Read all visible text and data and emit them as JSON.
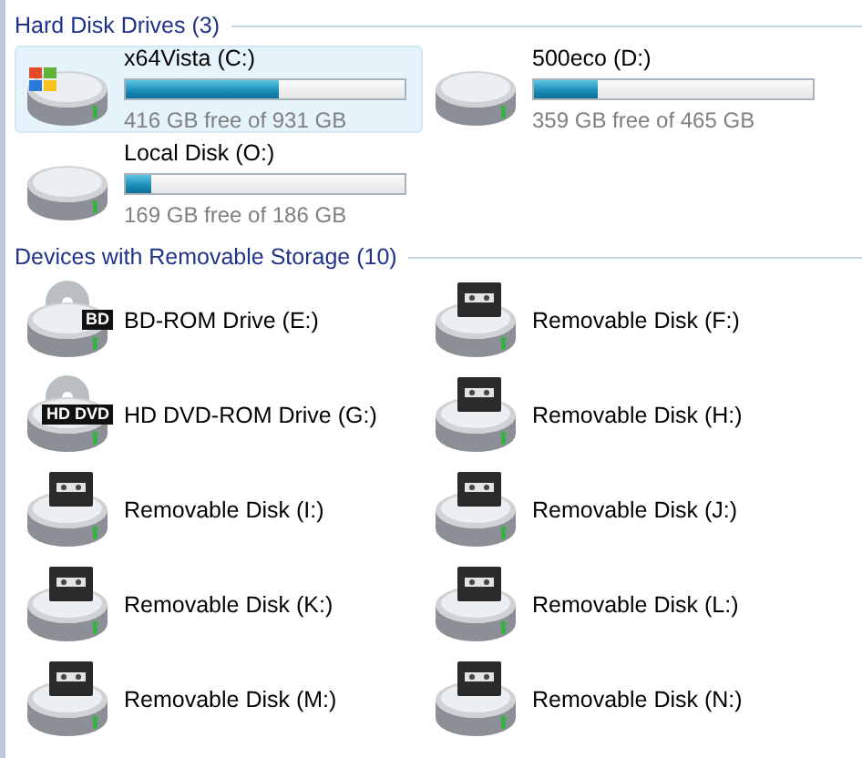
{
  "sections": [
    {
      "title": "Hard Disk Drives (3)",
      "items": [
        {
          "kind": "system-drive",
          "name": "x64Vista (C:)",
          "level": 0.55,
          "space": "416 GB free of 931 GB",
          "selected": true
        },
        {
          "kind": "hard-drive",
          "name": "500eco (D:)",
          "level": 0.23,
          "space": "359 GB free of 465 GB",
          "selected": false
        },
        {
          "kind": "hard-drive",
          "name": "Local Disk (O:)",
          "level": 0.09,
          "space": "169 GB free of 186 GB",
          "selected": false
        }
      ]
    },
    {
      "title": "Devices with Removable Storage (10)",
      "items": [
        {
          "kind": "optical-drive",
          "name": "BD-ROM Drive (E:)",
          "badge": "BD",
          "selected": false
        },
        {
          "kind": "removable-disk",
          "name": "Removable Disk (F:)",
          "selected": false
        },
        {
          "kind": "optical-drive",
          "name": "HD DVD-ROM Drive (G:)",
          "badge": "HD DVD",
          "selected": false
        },
        {
          "kind": "removable-disk",
          "name": "Removable Disk (H:)",
          "selected": false
        },
        {
          "kind": "removable-disk",
          "name": "Removable Disk (I:)",
          "selected": false
        },
        {
          "kind": "removable-disk",
          "name": "Removable Disk (J:)",
          "selected": false
        },
        {
          "kind": "removable-disk",
          "name": "Removable Disk (K:)",
          "selected": false
        },
        {
          "kind": "removable-disk",
          "name": "Removable Disk (L:)",
          "selected": false
        },
        {
          "kind": "removable-disk",
          "name": "Removable Disk (M:)",
          "selected": false
        },
        {
          "kind": "removable-disk",
          "name": "Removable Disk (N:)",
          "selected": false
        }
      ]
    }
  ]
}
